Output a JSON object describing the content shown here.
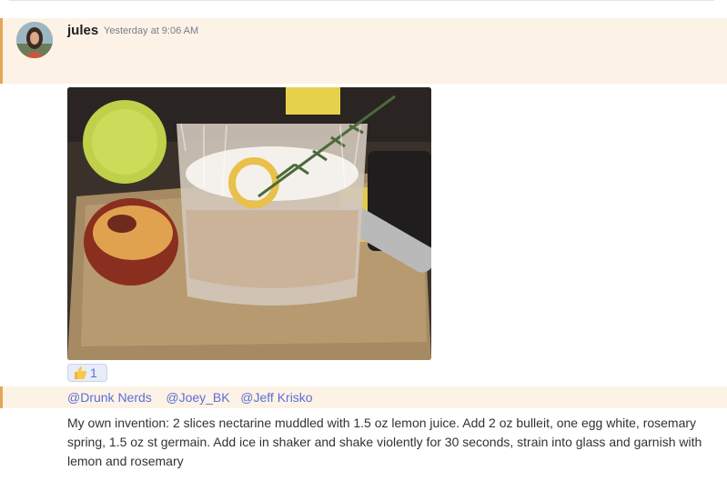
{
  "message": {
    "username": "jules",
    "timestamp": "Yesterday at 9:06 AM",
    "reactions": [
      {
        "emoji": "thumbs-up-icon",
        "count": "1"
      }
    ],
    "mentions": [
      "@Drunk Nerds",
      "@Joey_BK",
      "@Jeff Krisko"
    ],
    "text": "My own invention:  2 slices nectarine muddled with 1.5 oz lemon juice. Add 2 oz bulleit, one egg white, rosemary spring, 1.5 oz st germain. Add ice in shaker and shake violently for 30 seconds, strain into glass and garnish with lemon and rosemary"
  },
  "colors": {
    "mention_highlight_bg": "#fdf2e6",
    "mention_bar": "#e3a651",
    "mention_text": "#5b6fd6",
    "reaction_bg": "#e7ecf9"
  }
}
